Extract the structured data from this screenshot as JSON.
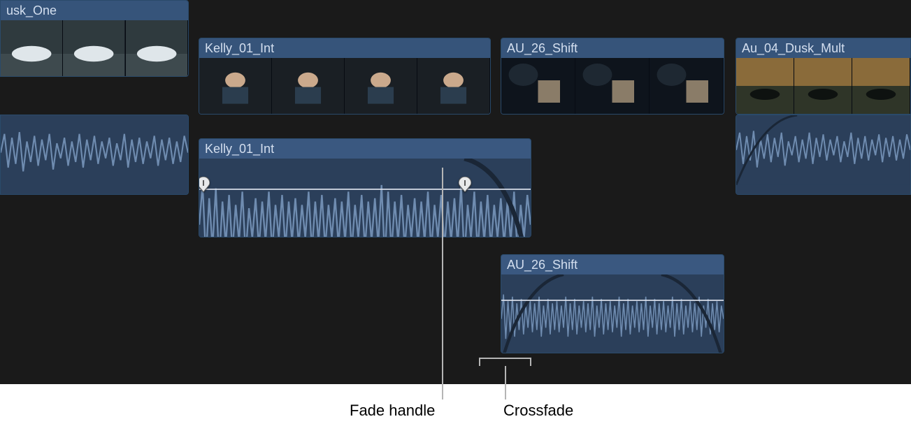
{
  "clips": {
    "dusk_one": {
      "label": "usk_One"
    },
    "kelly": {
      "label": "Kelly_01_Int"
    },
    "au_shift": {
      "label": "AU_26_Shift"
    },
    "dusk_mult": {
      "label": "Au_04_Dusk_Mult"
    }
  },
  "audio": {
    "kelly": {
      "label": "Kelly_01_Int"
    },
    "au_shift": {
      "label": "AU_26_Shift"
    }
  },
  "callouts": {
    "fade_handle": "Fade handle",
    "crossfade": "Crossfade"
  },
  "colors": {
    "clip_header": "#36547a",
    "clip_text": "#d4dfef",
    "audio_bg": "#2b3f5a",
    "wave": "#6f8cb0"
  }
}
